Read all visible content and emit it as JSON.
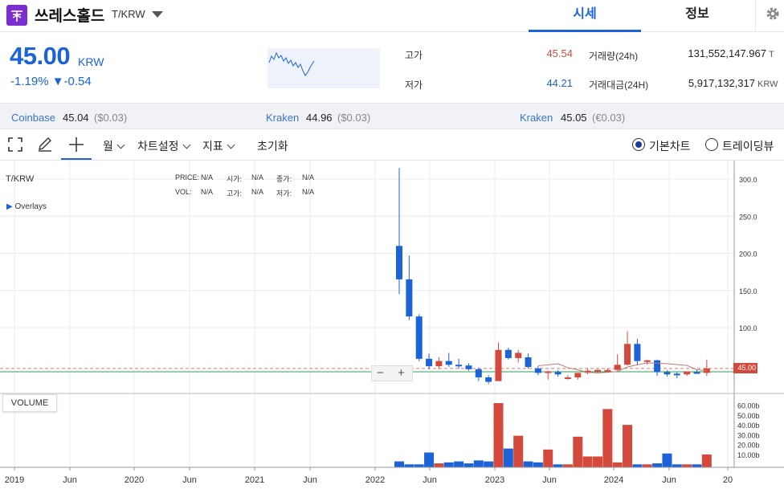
{
  "header": {
    "coin_name": "쓰레스홀드",
    "pair": "T/KRW",
    "tabs": [
      "시세",
      "정보"
    ],
    "icons": {
      "logo": "threshold-logo",
      "dropdown": "caret-down-icon",
      "settings": "gear-icon"
    }
  },
  "summary": {
    "price": "45.00",
    "unit": "KRW",
    "change": "-1.19% ▼-0.54",
    "high_label": "고가",
    "high_value": "45.54",
    "low_label": "저가",
    "low_value": "44.21",
    "volume_label": "거래량(24h)",
    "volume_value": "131,552,147.967",
    "volume_unit": "T",
    "amount_label": "거래대금(24H)",
    "amount_value": "5,917,132,317",
    "amount_unit": "KRW",
    "colors": {
      "up": "#d34a3c",
      "down": "#1b63d6"
    }
  },
  "exchanges": [
    {
      "name": "Coinbase",
      "price": "45.04",
      "diff": "($0.03)"
    },
    {
      "name": "Kraken",
      "price": "44.96",
      "diff": "($0.03)"
    },
    {
      "name": "Kraken",
      "price": "45.05",
      "diff": "(€0.03)"
    }
  ],
  "toolbar": {
    "icons": [
      "fullscreen-icon",
      "pencil-icon",
      "crosshair-icon"
    ],
    "interval": "월",
    "chart_settings": "차트설정",
    "indicators": "지표",
    "reset": "초기화",
    "basic_chart": "기본차트",
    "tradingview": "트레이딩뷰"
  },
  "chart_info": {
    "symbol": "T/KRW",
    "price_label": "PRICE:",
    "open_label": "시가:",
    "close_label": "종가:",
    "vol_label": "VOL:",
    "high_label": "고가:",
    "low_label": "저가:",
    "na": "N/A",
    "overlays": "Overlays",
    "volume_button": "VOLUME",
    "current_price_tag": "45.00"
  },
  "chart_data": {
    "type": "candlestick",
    "x_ticks": [
      "2019",
      "Jun",
      "2020",
      "Jun",
      "2021",
      "Jun",
      "2022",
      "Jun",
      "2023",
      "Jun",
      "2024",
      "Jun",
      "20"
    ],
    "y_ticks": [
      "300.0",
      "250.0",
      "200.0",
      "150.0",
      "100.0"
    ],
    "volume_ticks": [
      "60.00b",
      "50.00b",
      "40.00b",
      "30.00b",
      "20.00b",
      "10.00b"
    ],
    "ylim": [
      0,
      320
    ],
    "candles": [
      {
        "o": 210,
        "h": 315,
        "l": 145,
        "c": 165
      },
      {
        "o": 165,
        "h": 197,
        "l": 110,
        "c": 115
      },
      {
        "o": 115,
        "h": 118,
        "l": 55,
        "c": 58
      },
      {
        "o": 58,
        "h": 65,
        "l": 44,
        "c": 48
      },
      {
        "o": 48,
        "h": 60,
        "l": 44,
        "c": 55
      },
      {
        "o": 55,
        "h": 66,
        "l": 47,
        "c": 50
      },
      {
        "o": 50,
        "h": 58,
        "l": 45,
        "c": 49
      },
      {
        "o": 49,
        "h": 52,
        "l": 42,
        "c": 44
      },
      {
        "o": 44,
        "h": 46,
        "l": 28,
        "c": 33
      },
      {
        "o": 33,
        "h": 36,
        "l": 24,
        "c": 27
      },
      {
        "o": 28,
        "h": 80,
        "l": 28,
        "c": 70
      },
      {
        "o": 70,
        "h": 73,
        "l": 57,
        "c": 59
      },
      {
        "o": 59,
        "h": 70,
        "l": 53,
        "c": 66
      },
      {
        "o": 60,
        "h": 65,
        "l": 45,
        "c": 47
      },
      {
        "o": 45,
        "h": 48,
        "l": 36,
        "c": 39
      },
      {
        "o": 39,
        "h": 42,
        "l": 30,
        "c": 41
      },
      {
        "o": 40,
        "h": 43,
        "l": 34,
        "c": 37
      },
      {
        "o": 33,
        "h": 36,
        "l": 30,
        "c": 33
      },
      {
        "o": 33,
        "h": 38,
        "l": 30,
        "c": 39
      },
      {
        "o": 39,
        "h": 45,
        "l": 37,
        "c": 42
      },
      {
        "o": 41,
        "h": 44,
        "l": 38,
        "c": 43
      },
      {
        "o": 43,
        "h": 45,
        "l": 40,
        "c": 43
      },
      {
        "o": 43,
        "h": 64,
        "l": 42,
        "c": 50
      },
      {
        "o": 50,
        "h": 95,
        "l": 49,
        "c": 78
      },
      {
        "o": 78,
        "h": 85,
        "l": 49,
        "c": 55
      },
      {
        "o": 55,
        "h": 57,
        "l": 50,
        "c": 56
      },
      {
        "o": 56,
        "h": 57,
        "l": 35,
        "c": 40
      },
      {
        "o": 40,
        "h": 43,
        "l": 34,
        "c": 37
      },
      {
        "o": 38,
        "h": 40,
        "l": 32,
        "c": 36
      },
      {
        "o": 37,
        "h": 40,
        "l": 35,
        "c": 41
      },
      {
        "o": 40,
        "h": 43,
        "l": 38,
        "c": 39
      },
      {
        "o": 39,
        "h": 57,
        "l": 35,
        "c": 45
      }
    ],
    "volumes": [
      6,
      3,
      3,
      15,
      4,
      5,
      6,
      4,
      7,
      6,
      65,
      19,
      32,
      6,
      5,
      18,
      3,
      3,
      31,
      11,
      11,
      59,
      5,
      43,
      3,
      3,
      4,
      14,
      3,
      3,
      3,
      13
    ]
  }
}
